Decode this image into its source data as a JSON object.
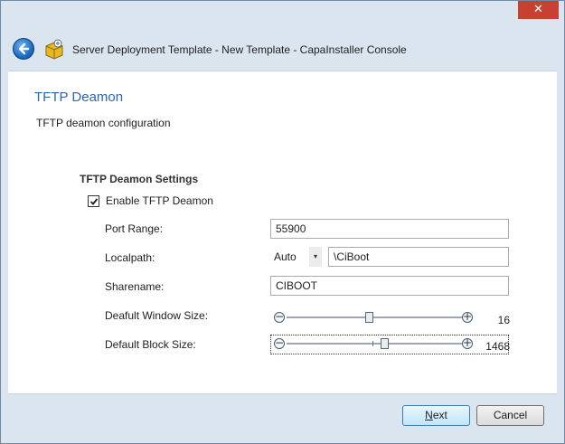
{
  "window": {
    "title": "Server Deployment Template - New Template - CapaInstaller Console",
    "close_glyph": "✕",
    "back_icon": "back-arrow-icon",
    "app_icon": "capainstaller-icon"
  },
  "page": {
    "title": "TFTP Deamon",
    "subtitle": "TFTP deamon configuration"
  },
  "settings": {
    "section_title": "TFTP Deamon Settings",
    "enable_label": "Enable TFTP Deamon",
    "enable_checked": true,
    "port_range": {
      "label": "Port Range:",
      "value": "55900"
    },
    "localpath": {
      "label": "Localpath:",
      "drive": "Auto",
      "path": "\\CiBoot",
      "dropdown_glyph": "▾"
    },
    "sharename": {
      "label": "Sharename:",
      "value": "CIBOOT"
    },
    "window_size": {
      "label": "Deafult Window Size:",
      "value": "16",
      "minus": "−",
      "plus": "+"
    },
    "block_size": {
      "label": "Default Block Size:",
      "value": "1468",
      "minus": "−",
      "plus": "+"
    }
  },
  "footer": {
    "next_first": "N",
    "next_rest": "ext",
    "cancel": "Cancel"
  }
}
